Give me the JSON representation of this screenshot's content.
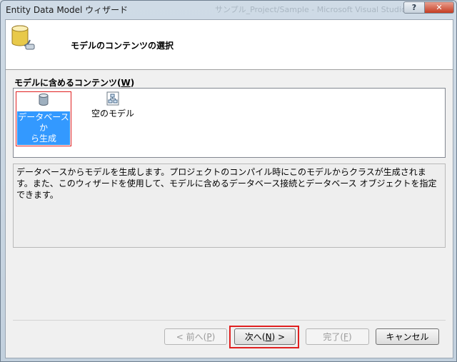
{
  "window": {
    "title": "Entity Data Model ウィザード",
    "background_title": "サンプル_Project/Sample - Microsoft Visual Studio",
    "help_label": "?",
    "close_label": "✕"
  },
  "header": {
    "icon": "database-wizard-icon",
    "page_title": "モデルのコンテンツの選択"
  },
  "contents": {
    "label": "モデルに含めるコンテンツ(W)",
    "items": [
      {
        "label_line1": "データベースか",
        "label_line2": "ら生成",
        "icon": "database-icon",
        "selected": true
      },
      {
        "label": "空のモデル",
        "icon": "empty-model-icon",
        "selected": false
      }
    ]
  },
  "description": "データベースからモデルを生成します。プロジェクトのコンパイル時にこのモデルからクラスが生成されます。また、このウィザードを使用して、モデルに含めるデータベース接続とデータベース オブジェクトを指定できます。",
  "buttons": {
    "back": "< 前へ(P)",
    "next": "次へ(N) >",
    "finish": "完了(F)",
    "cancel": "キャンセル"
  },
  "colors": {
    "selection": "#3399ff",
    "highlight_border": "#e02020",
    "close_button": "#c53c22"
  }
}
